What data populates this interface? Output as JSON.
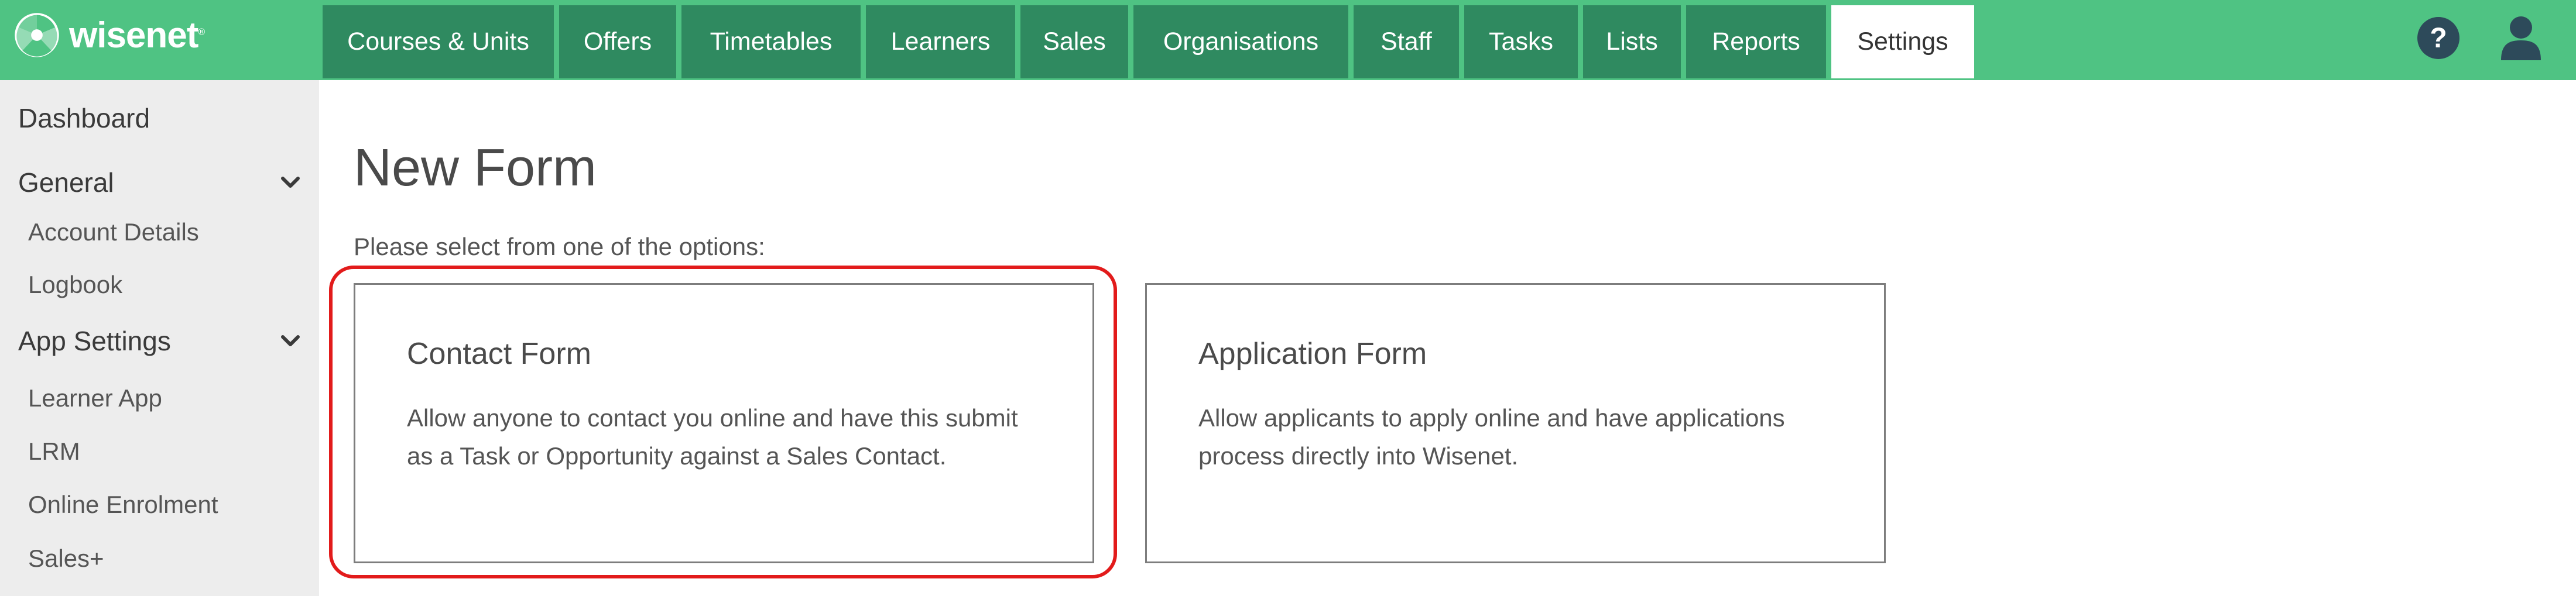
{
  "brand": {
    "name": "wisenet",
    "trademark": "®"
  },
  "nav": {
    "tabs": [
      {
        "label": "Courses & Units",
        "active": false
      },
      {
        "label": "Offers",
        "active": false
      },
      {
        "label": "Timetables",
        "active": false
      },
      {
        "label": "Learners",
        "active": false
      },
      {
        "label": "Sales",
        "active": false
      },
      {
        "label": "Organisations",
        "active": false
      },
      {
        "label": "Staff",
        "active": false
      },
      {
        "label": "Tasks",
        "active": false
      },
      {
        "label": "Lists",
        "active": false
      },
      {
        "label": "Reports",
        "active": false
      },
      {
        "label": "Settings",
        "active": true
      }
    ],
    "icons": {
      "help": "help-icon",
      "user": "user-icon"
    }
  },
  "sidebar": {
    "items": [
      {
        "label": "Dashboard",
        "level": "top"
      },
      {
        "label": "General",
        "level": "top",
        "expandable": true
      },
      {
        "label": "Account Details",
        "level": "sub"
      },
      {
        "label": "Logbook",
        "level": "sub"
      },
      {
        "label": "App Settings",
        "level": "top",
        "expandable": true
      },
      {
        "label": "Learner App",
        "level": "sub"
      },
      {
        "label": "LRM",
        "level": "sub"
      },
      {
        "label": "Online Enrolment",
        "level": "sub"
      },
      {
        "label": "Sales+",
        "level": "sub"
      }
    ]
  },
  "main": {
    "title": "New Form",
    "subtitle": "Please select from one of the options:",
    "cards": [
      {
        "title": "Contact Form",
        "description": "Allow anyone to contact you online and have this submit as a Task or Opportunity against a Sales Contact.",
        "highlighted": true
      },
      {
        "title": "Application Form",
        "description": "Allow applicants to apply online and have applications process directly into Wisenet.",
        "highlighted": false
      }
    ]
  },
  "colors": {
    "brand_green": "#4fc383",
    "tab_dark_green": "#2f8a60",
    "sidebar_bg": "#ededed",
    "highlight_red": "#e21b1b",
    "icon_dark": "#2d4a5a"
  }
}
